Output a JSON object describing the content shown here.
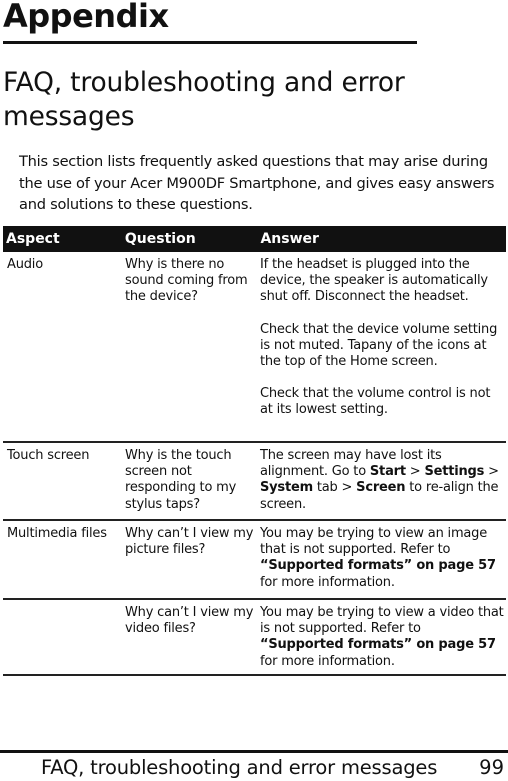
{
  "chapter": {
    "title": "Appendix"
  },
  "section": {
    "title": "FAQ, troubleshooting and error messages"
  },
  "intro": "This section lists frequently asked questions that may arise during the use of your Acer M900DF Smartphone, and gives easy answers and solutions to these questions.",
  "table": {
    "headers": [
      "Aspect",
      "Question",
      "Answer"
    ],
    "header_bg": "#111111",
    "rows": [
      {
        "aspect": "Audio",
        "question": "Why is there no sound coming from the device?",
        "answer": [
          {
            "pre": "If the headset is plugged into the device, the speaker is automatically shut off. Disconnect the headset."
          },
          {
            "pre": "Check that the device volume setting is not muted. Tapany of the icons at the top of the Home screen."
          },
          {
            "pre": "Check that the volume control is not at its lowest setting."
          }
        ]
      },
      {
        "aspect": "Touch screen",
        "question": "Why is the touch screen not responding to my stylus taps?",
        "answer": [
          {
            "pre": "The screen may have lost its alignment. Go to ",
            "b1": "Start",
            "s1": " > ",
            "b2": "Settings",
            "s2": " > ",
            "b3": "System",
            "s3": " tab > ",
            "b4": "Screen",
            "post": " to re-align the screen."
          }
        ]
      },
      {
        "aspect": "Multimedia files",
        "question": "Why can’t I view my picture files?",
        "answer": [
          {
            "pre": "You may be trying to view an image that is not supported. Refer to ",
            "b1": "“Supported formats” on page 57",
            "post": " for more information."
          }
        ]
      },
      {
        "aspect": "",
        "question": "Why can’t I view my video files?",
        "answer": [
          {
            "pre": "You may be trying to view a video that is not supported. Refer to ",
            "b1": "“Supported formats” on page 57",
            "post": " for more information."
          }
        ]
      }
    ]
  },
  "footer": {
    "text": "FAQ, troubleshooting and error messages",
    "page_number": "99"
  }
}
